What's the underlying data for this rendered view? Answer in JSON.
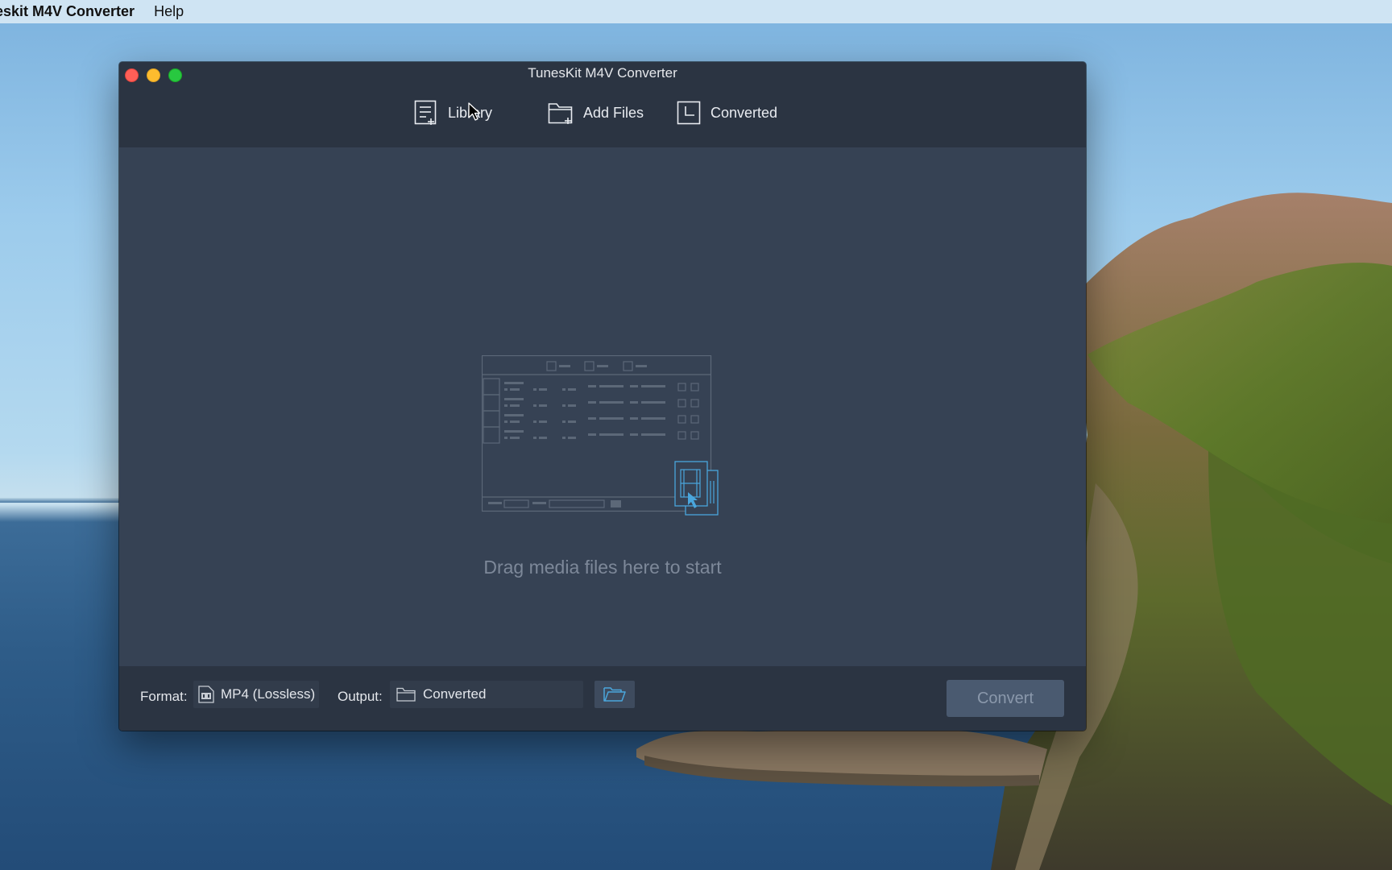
{
  "menubar": {
    "app_name": "eskit M4V Converter",
    "help": "Help"
  },
  "window": {
    "title": "TunesKit M4V Converter",
    "toolbar": {
      "library": "Library",
      "add_files": "Add Files",
      "converted": "Converted"
    },
    "drop_hint": "Drag media files here to start",
    "bottom": {
      "format_label": "Format:",
      "format_value": "MP4 (Lossless)",
      "output_label": "Output:",
      "output_value": "Converted",
      "convert": "Convert"
    }
  },
  "icons": {
    "library": "library-icon",
    "add_files": "add-folder-icon",
    "converted": "converted-icon",
    "format": "file-format-icon",
    "output": "folder-icon",
    "browse": "open-folder-icon",
    "illustration": "drag-drop-illustration-icon"
  },
  "colors": {
    "window_bg": "#364254",
    "toolbar_bg": "#2b3442",
    "accent": "#4aa6dc",
    "convert_disabled": "#4a5a70"
  }
}
